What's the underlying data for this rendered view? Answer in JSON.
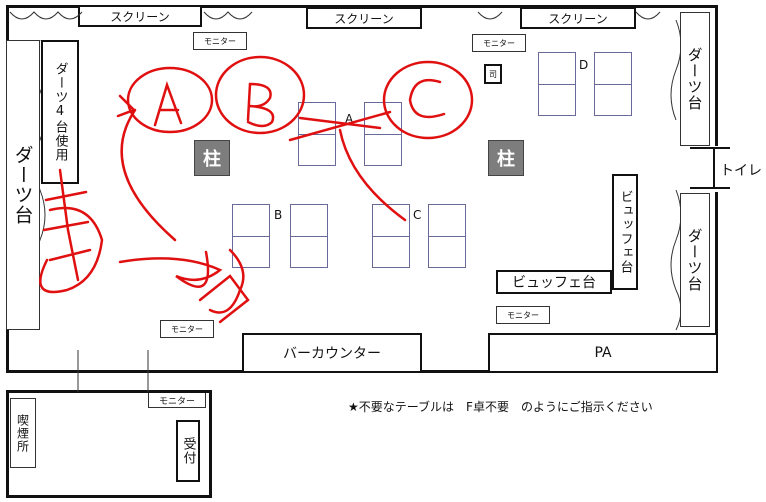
{
  "screens": [
    "スクリーン",
    "スクリーン",
    "スクリーン"
  ],
  "monitor_label": "モニター",
  "darts_left": "ダーツ台",
  "darts_four": "ダーツ4台使用",
  "darts_right_top": "ダーツ台",
  "darts_right_bottom": "ダーツ台",
  "pillar": "柱",
  "tables": {
    "A": "A",
    "B": "B",
    "C": "C",
    "D": "D"
  },
  "small_box": "司",
  "buffet_vertical": "ビュッフェ台",
  "buffet_horizontal": "ビュッフェ台",
  "toilet": "トイレ",
  "bar_counter": "バーカウンター",
  "pa": "PA",
  "smoking": "喫煙所",
  "reception": "受付",
  "note": "★不要なテーブルは　F卓不要　のようにご指示ください",
  "annotation_color": "#e01010"
}
